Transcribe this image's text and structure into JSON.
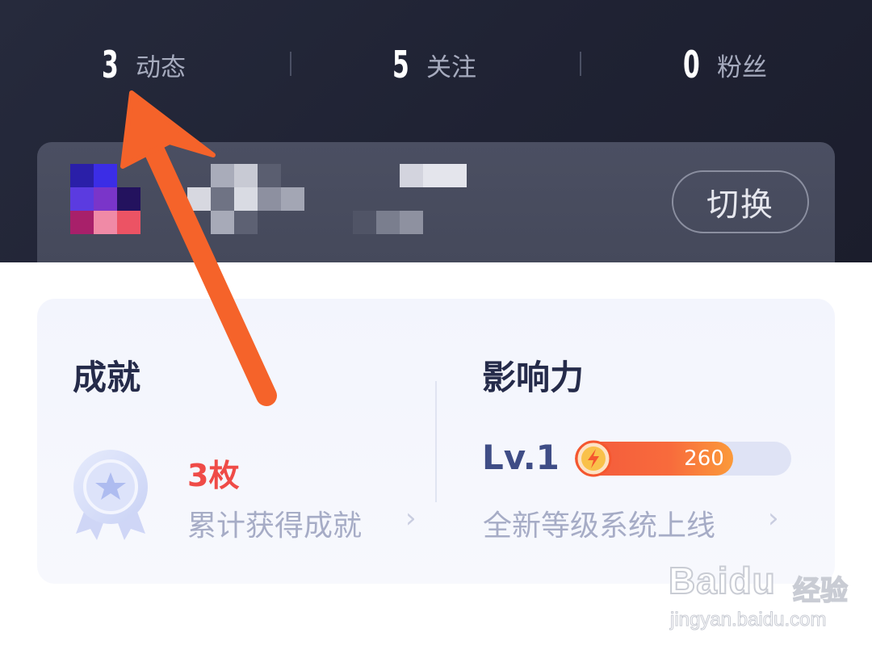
{
  "stats": [
    {
      "value": "3",
      "label": "动态"
    },
    {
      "value": "5",
      "label": "关注"
    },
    {
      "value": "0",
      "label": "粉丝"
    }
  ],
  "account": {
    "switch_label": "切换"
  },
  "achievement": {
    "title": "成就",
    "count": "3枚",
    "subtitle": "累计获得成就",
    "chevron": "›"
  },
  "influence": {
    "title": "影响力",
    "level": "Lv.1",
    "points": "260",
    "progress_fraction": 0.73,
    "subtitle": "全新等级系统上线",
    "chevron": "›"
  },
  "watermark": {
    "brand": "Baidu",
    "brand_cn": "经验",
    "url": "jingyan.baidu.com"
  },
  "colors": {
    "header_bg": "#1f2233",
    "accent_red": "#ef4b47",
    "level_blue": "#3f4d86",
    "arrow_orange": "#f5632a"
  },
  "icons": {
    "medal": "medal-icon",
    "lightning": "lightning-icon",
    "arrow": "annotation-arrow-icon"
  }
}
